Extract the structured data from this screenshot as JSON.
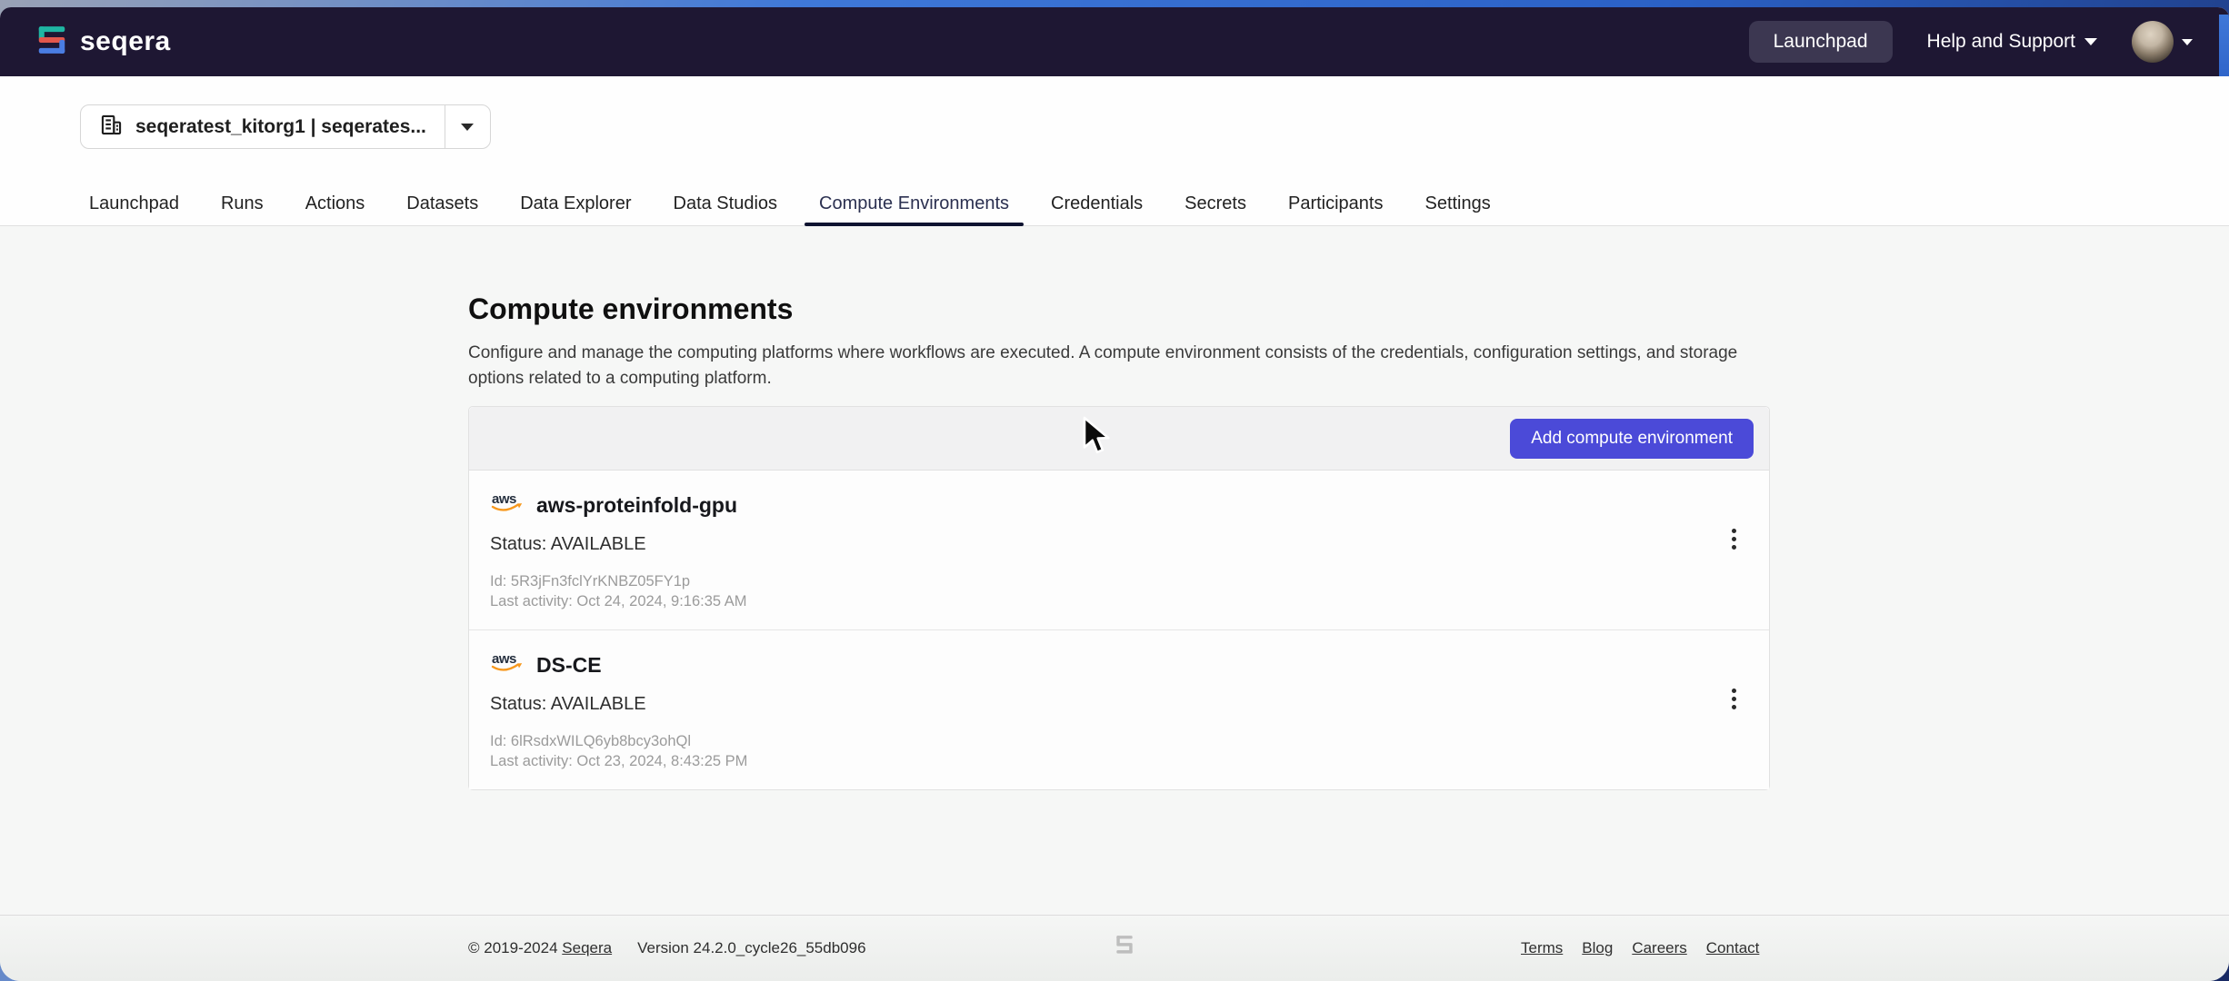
{
  "navbar": {
    "brand": "seqera",
    "launchpad_label": "Launchpad",
    "help_label": "Help and Support"
  },
  "workspace": {
    "selector_label": "seqeratest_kitorg1 | seqerates..."
  },
  "tabs": [
    {
      "label": "Launchpad",
      "active": false
    },
    {
      "label": "Runs",
      "active": false
    },
    {
      "label": "Actions",
      "active": false
    },
    {
      "label": "Datasets",
      "active": false
    },
    {
      "label": "Data Explorer",
      "active": false
    },
    {
      "label": "Data Studios",
      "active": false
    },
    {
      "label": "Compute Environments",
      "active": true
    },
    {
      "label": "Credentials",
      "active": false
    },
    {
      "label": "Secrets",
      "active": false
    },
    {
      "label": "Participants",
      "active": false
    },
    {
      "label": "Settings",
      "active": false
    }
  ],
  "main": {
    "title": "Compute environments",
    "description": "Configure and manage the computing platforms where workflows are executed. A compute environment consists of the credentials, configuration settings, and storage options related to a computing platform.",
    "add_button_label": "Add compute environment",
    "environments": [
      {
        "provider": "aws",
        "name": "aws-proteinfold-gpu",
        "status_label": "Status: AVAILABLE",
        "id_label": "Id: 5R3jFn3fclYrKNBZ05FY1p",
        "last_activity_label": "Last activity: Oct 24, 2024, 9:16:35 AM"
      },
      {
        "provider": "aws",
        "name": "DS-CE",
        "status_label": "Status: AVAILABLE",
        "id_label": "Id: 6lRsdxWILQ6yb8bcy3ohQl",
        "last_activity_label": "Last activity: Oct 23, 2024, 8:43:25 PM"
      }
    ]
  },
  "footer": {
    "copyright_prefix": "© 2019-2024",
    "copyright_link": "Seqera",
    "version": "Version 24.2.0_cycle26_55db096",
    "links": [
      "Terms",
      "Blog",
      "Careers",
      "Contact"
    ]
  },
  "colors": {
    "accent": "#4b4ad8",
    "navbar_bg": "#1e1733",
    "active_tab_underline": "#0e1330",
    "aws_orange": "#f7981d",
    "logo_teal": "#1fb5a3",
    "logo_coral": "#e2574c",
    "logo_blue": "#4a7de2"
  }
}
